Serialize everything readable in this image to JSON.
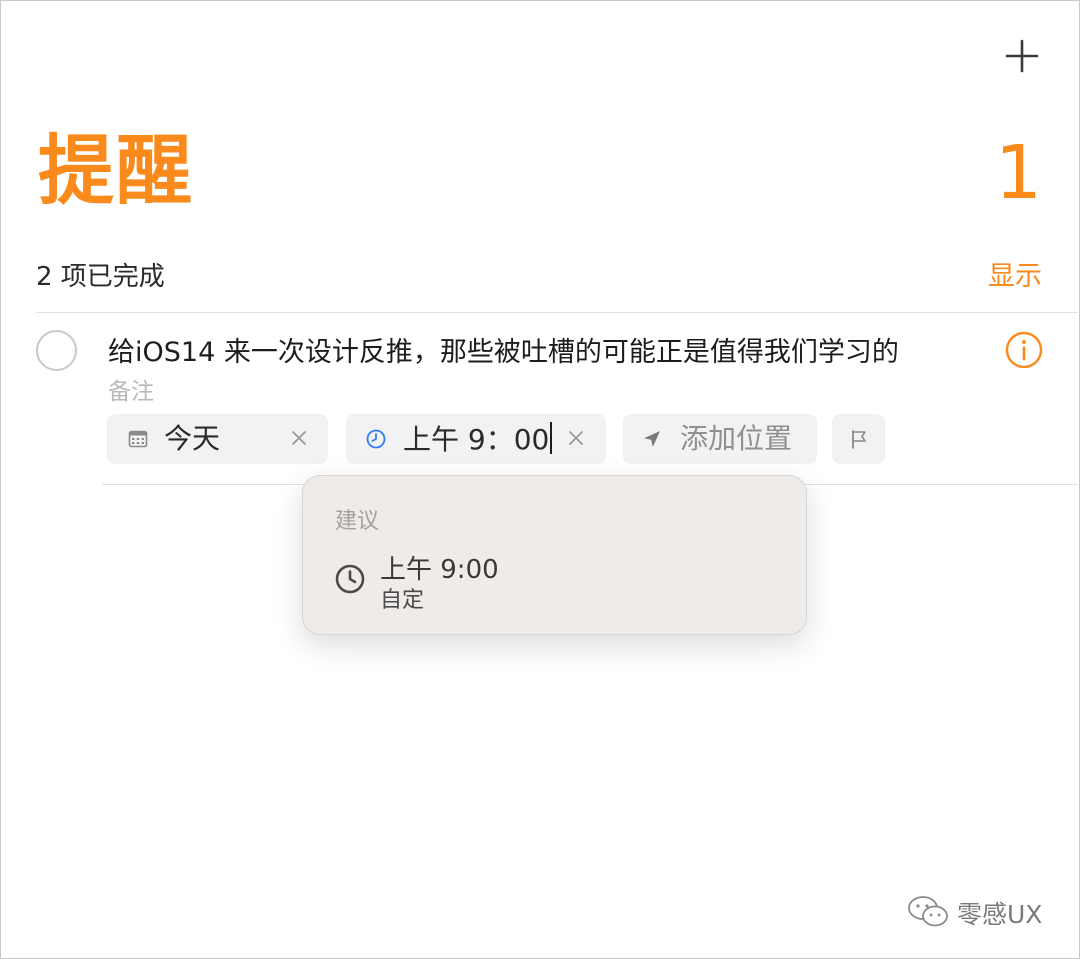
{
  "header": {
    "add_icon": "plus-icon",
    "title": "提醒",
    "count": "1"
  },
  "completed": {
    "text": "2 项已完成",
    "show_label": "显示"
  },
  "reminder": {
    "title": "给iOS14 来一次设计反推，那些被吐槽的可能正是值得我们学习的",
    "notes_placeholder": "备注",
    "info_icon": "info-icon",
    "date_chip": {
      "icon": "calendar-icon",
      "value": "今天"
    },
    "time_chip": {
      "icon": "clock-icon",
      "value": "上午 9：00"
    },
    "location_chip": {
      "icon": "location-arrow-icon",
      "label": "添加位置"
    },
    "flag_chip": {
      "icon": "flag-icon"
    }
  },
  "suggestions": {
    "heading": "建议",
    "items": [
      {
        "icon": "clock-icon",
        "time": "上午 9:00",
        "subtitle": "自定"
      }
    ]
  },
  "watermark": {
    "text": "零感UX"
  },
  "colors": {
    "accent": "#fb8a1c",
    "time_icon": "#2f7cf6",
    "popover_bg": "#efebe8"
  }
}
